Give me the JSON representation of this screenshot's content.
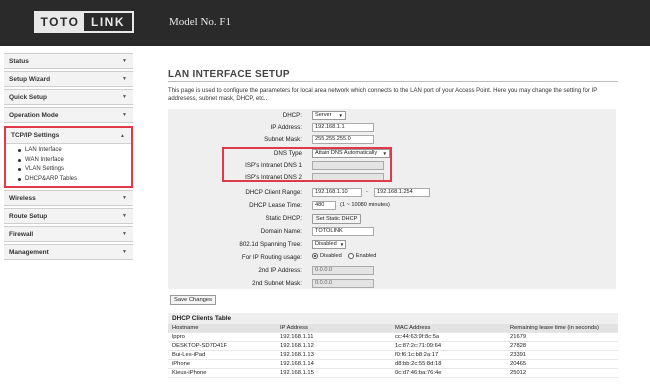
{
  "header": {
    "logo_left": "TOTO",
    "logo_right": "LINK",
    "model": "Model No. F1"
  },
  "sidebar": {
    "items": [
      {
        "label": "Status"
      },
      {
        "label": "Setup Wizard"
      },
      {
        "label": "Quick Setup"
      },
      {
        "label": "Operation Mode"
      },
      {
        "label": "TCP/IP Settings"
      },
      {
        "label": "Wireless"
      },
      {
        "label": "Route Setup"
      },
      {
        "label": "Firewall"
      },
      {
        "label": "Management"
      }
    ],
    "tcp_sub": [
      "LAN Interface",
      "WAN Interface",
      "VLAN Settings",
      "DHCP&ARP Tables"
    ]
  },
  "main": {
    "title": "LAN INTERFACE SETUP",
    "intro": "This page is used to configure the parameters for local area network which connects to the LAN port of your Access Point. Here you may change the setting for IP addresess, subnet mask, DHCP, etc..",
    "form": {
      "dhcp_label": "DHCP:",
      "dhcp_value": "Server",
      "ip_label": "IP Address:",
      "ip_value": "192.168.1.1",
      "mask_label": "Subnet Mask:",
      "mask_value": "255.255.255.0",
      "dnstype_label": "DNS Type",
      "dnstype_value": "Attain DNS Automatically",
      "dns1_label": "ISP's Intranet DNS 1",
      "dns1_value": "",
      "dns2_label": "ISP's Intranet DNS 2",
      "dns2_value": "",
      "range_label": "DHCP Client Range:",
      "range_start": "192.168.1.10",
      "range_dash": "-",
      "range_end": "192.168.1.254",
      "lease_label": "DHCP Lease Time:",
      "lease_value": "480",
      "lease_unit": "(1 ~ 10080 minutes)",
      "static_label": "Static DHCP:",
      "static_button": "Set Static DHCP",
      "domain_label": "Domain Name:",
      "domain_value": "TOTOLINK",
      "stp_label": "802.1d Spanning Tree:",
      "stp_value": "Disabled",
      "routing_label": "For IP Routing usage:",
      "routing_disabled": "Disabled",
      "routing_enabled": "Enabled",
      "ip2_label": "2nd IP Address:",
      "ip2_value": "0.0.0.0",
      "mask2_label": "2nd Subnet Mask:",
      "mask2_value": "0.0.0.0"
    },
    "save_button": "Save Changes",
    "dhcp_table": {
      "title": "DHCP Clients Table",
      "headers": [
        "Hostname",
        "IP Address",
        "MAC Address",
        "Remaining lease time (in seconds)"
      ],
      "rows": [
        [
          "lppro",
          "192.168.1.11",
          "cc:44:63:9f:8c:5a",
          "21679"
        ],
        [
          "DESKTOP-SD7D41F",
          "192.168.1.12",
          "1c:87:2c:71:09:64",
          "27828"
        ],
        [
          "Bui-Les-iPad",
          "192.168.1.13",
          "f0:f6:1c:b8:2a:17",
          "23391"
        ],
        [
          "iPhone",
          "192.168.1.14",
          "d8:bb:2c:55:8d:18",
          "20465"
        ],
        [
          "Kieus-iPhone",
          "192.168.1.15",
          "0c:d7:46:ba:76:4e",
          "25012"
        ]
      ]
    }
  },
  "colors": {
    "header_bg": "#2a2a2a",
    "highlight": "#e03a48",
    "form_bg": "#efefef"
  }
}
